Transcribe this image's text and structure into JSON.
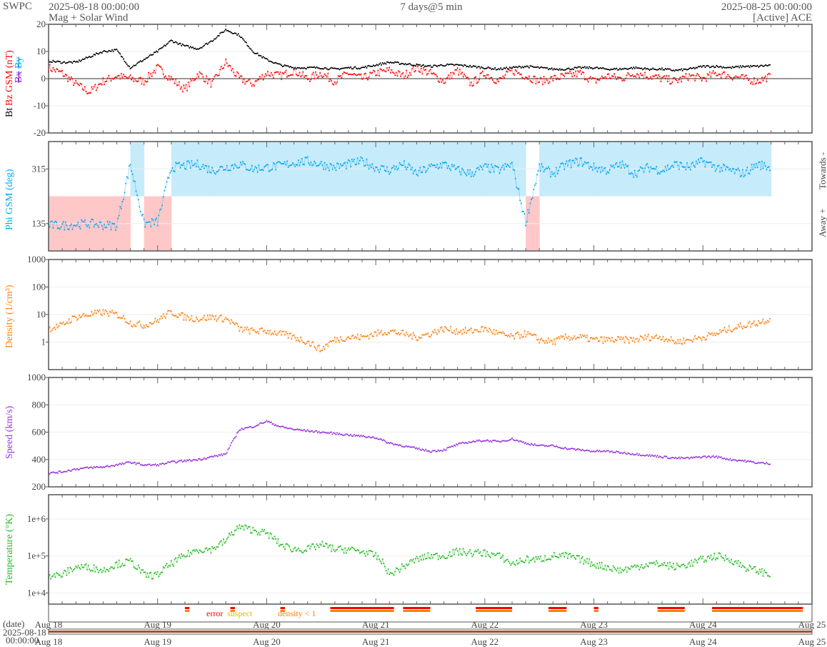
{
  "header": {
    "org": "SWPC",
    "start": "2025-08-18 00:00:00",
    "product": "Mag + Solar Wind",
    "span": "7 days@5 min",
    "end": "2025-08-25 00:00:00",
    "source": "[Active] ACE"
  },
  "bottom": {
    "date_label": "(date)",
    "start_date": "2025-08-18",
    "start_time": "00:00:00",
    "flags": {
      "error": "error",
      "suspect": "suspect",
      "density": "density < 1"
    }
  },
  "colors": {
    "bt": "#000000",
    "bz": "#ff0000",
    "bx": "#8a2be2",
    "by": "#00a8f0",
    "phi": "#00a8f0",
    "towards_band": "#c6ebfb",
    "away_band": "#ffc8c8",
    "density": "#ff7f0e",
    "speed": "#9933dd",
    "temp": "#22bb22"
  },
  "chart_data": [
    {
      "type": "line",
      "title": "Magnetic field",
      "ylabels": {
        "bt": "Bt",
        "bz": "Bz GSM (nT)",
        "bx": "Bx",
        "by": "By"
      },
      "ylim": [
        -20,
        20
      ],
      "yticks": [
        "20",
        "10",
        "0",
        "-10",
        "-20"
      ],
      "x_hours_step": 3,
      "series": [
        {
          "name": "Bt",
          "values": [
            6.5,
            6,
            6,
            8,
            10,
            10.5,
            4,
            7,
            10,
            14,
            12,
            11,
            14,
            18,
            16,
            10,
            7,
            5,
            4,
            4,
            4,
            3.5,
            4,
            4,
            5,
            6,
            5.5,
            5,
            4.5,
            5,
            5,
            4.5,
            4,
            3.5,
            4,
            4.5,
            4,
            3.5,
            3.5,
            4,
            4,
            3.5,
            3.5,
            4,
            3.5,
            3.5,
            3,
            3.5,
            4.5,
            4.5,
            4,
            4.5,
            4.5,
            5
          ]
        },
        {
          "name": "Bz",
          "values": [
            4,
            2,
            -2,
            -5,
            -1,
            1,
            0,
            -1,
            4,
            0,
            -4,
            2,
            -2,
            6,
            0,
            -2,
            2,
            1,
            3,
            0,
            2,
            -1,
            2,
            0,
            2,
            3,
            1,
            4,
            2,
            -1,
            3,
            -2,
            2,
            -1,
            3,
            1,
            -1,
            0,
            1,
            2,
            -1,
            1,
            0,
            2,
            1,
            0,
            -1,
            1,
            0,
            2,
            1,
            0,
            -1,
            1
          ]
        }
      ]
    },
    {
      "type": "scatter",
      "title": "Phi GSM",
      "ylabel": "Phi GSM (deg)",
      "right_labels": {
        "towards": "Towards -",
        "away": "Away +"
      },
      "ylim": [
        45,
        405
      ],
      "yticks": [
        "315",
        "135"
      ],
      "x_hours_step": 3,
      "series": [
        {
          "name": "Phi",
          "values": [
            130,
            128,
            132,
            135,
            130,
            128,
            330,
            135,
            140,
            320,
            325,
            330,
            310,
            320,
            330,
            315,
            320,
            325,
            335,
            340,
            330,
            320,
            330,
            340,
            320,
            310,
            330,
            300,
            320,
            330,
            310,
            300,
            320,
            310,
            330,
            140,
            320,
            300,
            330,
            340,
            320,
            310,
            330,
            300,
            320,
            310,
            330,
            320,
            340,
            320,
            310,
            300,
            330,
            320
          ]
        }
      ]
    },
    {
      "type": "line",
      "title": "Density",
      "ylabel": "Density (1/cm³)",
      "yscale": "log",
      "ylim": [
        0.1,
        1000
      ],
      "yticks": [
        "1000",
        "100",
        "10",
        "1"
      ],
      "x_hours_step": 3,
      "series": [
        {
          "name": "Density",
          "values": [
            3,
            4,
            8,
            10,
            12,
            10,
            5,
            4,
            6,
            12,
            8,
            7,
            8,
            7,
            3,
            2.5,
            2.5,
            2,
            1.5,
            1,
            0.5,
            1.2,
            1.5,
            1.5,
            2,
            2.5,
            2,
            1.5,
            2,
            3,
            2.5,
            2.5,
            3,
            2,
            1.5,
            2,
            1.2,
            1,
            1.5,
            1.5,
            1.2,
            1.2,
            1.2,
            1.2,
            1.5,
            1.5,
            1,
            1.2,
            1.5,
            2,
            3,
            4,
            5,
            7
          ]
        }
      ]
    },
    {
      "type": "line",
      "title": "Speed",
      "ylabel": "Speed (km/s)",
      "ylim": [
        200,
        1000
      ],
      "yticks": [
        "1000",
        "800",
        "600",
        "400",
        "200"
      ],
      "x_hours_step": 3,
      "series": [
        {
          "name": "Speed",
          "values": [
            300,
            310,
            330,
            340,
            345,
            360,
            380,
            360,
            360,
            380,
            390,
            400,
            420,
            440,
            620,
            640,
            680,
            640,
            620,
            610,
            600,
            590,
            580,
            570,
            560,
            520,
            500,
            480,
            460,
            470,
            510,
            530,
            540,
            530,
            550,
            520,
            500,
            500,
            480,
            470,
            460,
            460,
            450,
            440,
            430,
            420,
            410,
            410,
            420,
            420,
            400,
            390,
            375,
            370
          ]
        }
      ]
    },
    {
      "type": "line",
      "title": "Temperature",
      "ylabel": "Temperature (°K)",
      "yscale": "log",
      "ylim": [
        5000,
        4500000
      ],
      "yticks": [
        "1e+6",
        "1e+5",
        "1e+4"
      ],
      "x_hours_step": 3,
      "series": [
        {
          "name": "Temperature",
          "values": [
            30000,
            30000,
            50000,
            50000,
            40000,
            60000,
            70000,
            30000,
            30000,
            60000,
            100000,
            150000,
            150000,
            250000,
            600000,
            500000,
            400000,
            200000,
            150000,
            150000,
            200000,
            150000,
            150000,
            130000,
            100000,
            30000,
            50000,
            80000,
            100000,
            100000,
            130000,
            120000,
            120000,
            100000,
            60000,
            80000,
            80000,
            100000,
            100000,
            80000,
            60000,
            50000,
            40000,
            50000,
            60000,
            60000,
            50000,
            60000,
            80000,
            100000,
            80000,
            50000,
            40000,
            30000
          ]
        }
      ]
    },
    {
      "type": "table",
      "title": "Quality flags (hour ranges since start)",
      "flag_ranges": [
        [
          30,
          31
        ],
        [
          40,
          41
        ],
        [
          51,
          52
        ],
        [
          62,
          76
        ],
        [
          78,
          84
        ],
        [
          94,
          102
        ],
        [
          110,
          114
        ],
        [
          120,
          121
        ],
        [
          134,
          140
        ],
        [
          146,
          166
        ],
        [
          172,
          182
        ]
      ],
      "xticks": [
        "Aug 18",
        "Aug 19",
        "Aug 20",
        "Aug 21",
        "Aug 22",
        "Aug 23",
        "Aug 24",
        "Aug 25"
      ]
    }
  ]
}
